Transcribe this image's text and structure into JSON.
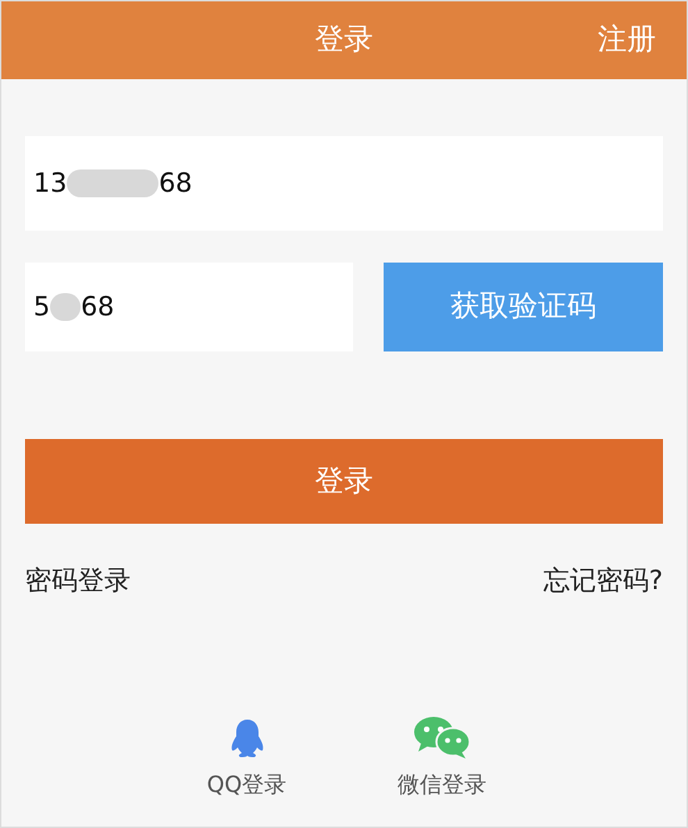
{
  "header": {
    "title": "登录",
    "register": "注册"
  },
  "phone_field": {
    "value_start": "13",
    "value_end": "68"
  },
  "code_field": {
    "value_start": "5",
    "value_end": "68"
  },
  "get_code_button": "获取验证码",
  "login_button": "登录",
  "links": {
    "password_login": "密码登录",
    "forgot_password": "忘记密码?"
  },
  "social_logins": [
    {
      "kind": "qq",
      "label": "QQ登录"
    },
    {
      "kind": "wechat",
      "label": "微信登录"
    }
  ]
}
